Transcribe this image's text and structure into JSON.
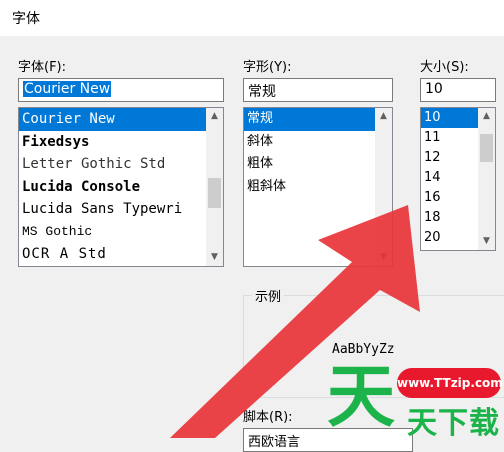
{
  "window": {
    "title": "字体"
  },
  "font": {
    "label": "字体(F):",
    "value": "Courier New",
    "items": [
      "Courier New",
      "Fixedsys",
      "Letter Gothic Std",
      "Lucida Console",
      "Lucida Sans Typewri",
      "MS Gothic",
      "OCR A Std"
    ]
  },
  "style": {
    "label": "字形(Y):",
    "value": "常规",
    "items": [
      "常规",
      "斜体",
      "粗体",
      "粗斜体"
    ]
  },
  "size": {
    "label": "大小(S):",
    "value": "10",
    "items": [
      "10",
      "11",
      "12",
      "14",
      "16",
      "18",
      "20"
    ]
  },
  "sample": {
    "label": "示例",
    "text": "AaBbYyZz"
  },
  "script": {
    "label": "脚本(R):",
    "value": "西欧语言"
  },
  "icons": {
    "scroll_up": "chevron-up-icon",
    "scroll_down": "chevron-down-icon"
  },
  "colors": {
    "selection": "#0078d7",
    "annotation_arrow": "#e8343a",
    "watermark_green": "#1bb34a",
    "watermark_red": "#e8192c"
  },
  "watermark": {
    "badge": "www.TTzip.com",
    "big": "天",
    "small": "天下载"
  }
}
